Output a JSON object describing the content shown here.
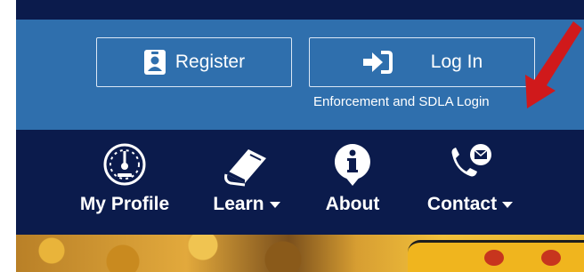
{
  "auth": {
    "register_label": "Register",
    "login_label": "Log In",
    "secondary_link": "Enforcement and SDLA Login"
  },
  "nav": {
    "items": [
      {
        "label": "My Profile",
        "icon": "gauge-icon",
        "dropdown": false
      },
      {
        "label": "Learn",
        "icon": "book-icon",
        "dropdown": true
      },
      {
        "label": "About",
        "icon": "info-icon",
        "dropdown": false
      },
      {
        "label": "Contact",
        "icon": "phone-mail-icon",
        "dropdown": true
      }
    ]
  },
  "colors": {
    "header_dark": "#0b1b4c",
    "auth_bar": "#2f6fad",
    "annotation_arrow": "#d0191b"
  }
}
